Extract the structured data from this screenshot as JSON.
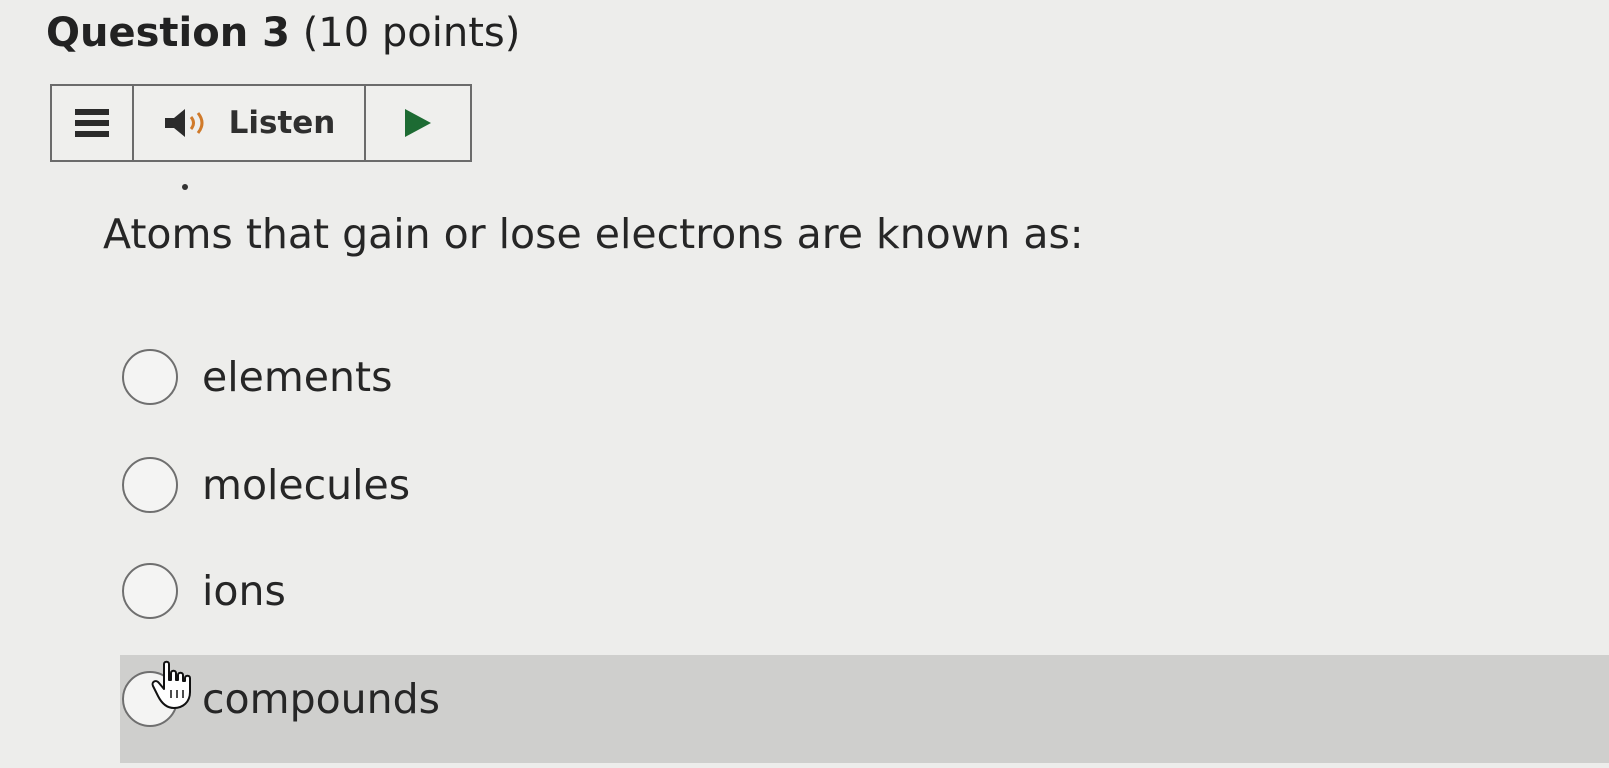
{
  "question": {
    "number_label": "Question 3",
    "points_label": "(10 points)",
    "text": "Atoms that gain or lose electrons are known as:"
  },
  "toolbar": {
    "menu_icon": "menu-icon",
    "speaker_icon": "speaker-icon",
    "listen_label": "Listen",
    "play_icon": "play-icon"
  },
  "choices": [
    {
      "label": "elements",
      "selected": false,
      "hovered": false
    },
    {
      "label": "molecules",
      "selected": false,
      "hovered": false
    },
    {
      "label": "ions",
      "selected": false,
      "hovered": false
    },
    {
      "label": "compounds",
      "selected": false,
      "hovered": true
    }
  ],
  "colors": {
    "background": "#ededeb",
    "hover_row": "#cfcfcd",
    "border": "#6b6b6b",
    "text": "#262626"
  }
}
